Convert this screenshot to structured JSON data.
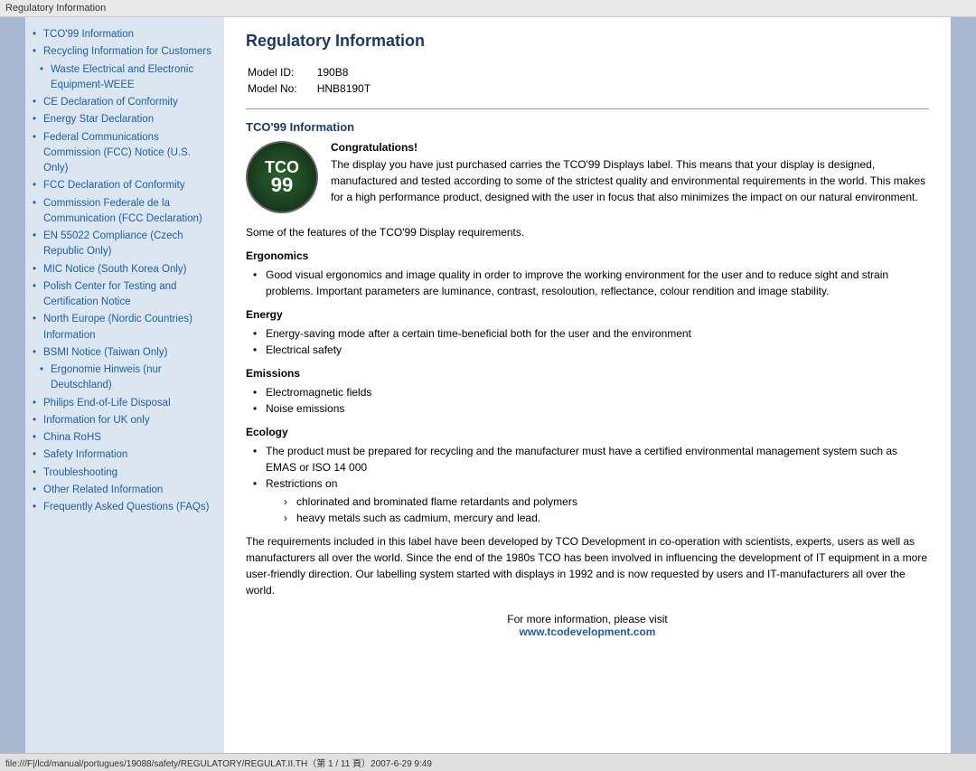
{
  "titleBar": {
    "label": "Regulatory Information"
  },
  "sidebar": {
    "items": [
      {
        "label": "TCO'99 Information",
        "indent": false
      },
      {
        "label": "Recycling Information for Customers",
        "indent": false
      },
      {
        "label": "Waste Electrical and Electronic Equipment-WEEE",
        "indent": true
      },
      {
        "label": "CE Declaration of Conformity",
        "indent": false
      },
      {
        "label": "Energy Star Declaration",
        "indent": false
      },
      {
        "label": "Federal Communications Commission (FCC) Notice (U.S. Only)",
        "indent": false
      },
      {
        "label": "FCC Declaration of Conformity",
        "indent": false
      },
      {
        "label": "Commission Federale de la Communication (FCC Declaration)",
        "indent": false
      },
      {
        "label": "EN 55022 Compliance (Czech Republic Only)",
        "indent": false
      },
      {
        "label": "MIC Notice (South Korea Only)",
        "indent": false
      },
      {
        "label": "Polish Center for Testing and Certification Notice",
        "indent": false
      },
      {
        "label": "North Europe (Nordic Countries) Information",
        "indent": false
      },
      {
        "label": "BSMI Notice (Taiwan Only)",
        "indent": false
      },
      {
        "label": "Ergonomie Hinweis (nur Deutschland)",
        "indent": true
      },
      {
        "label": "Philips End-of-Life Disposal",
        "indent": false
      },
      {
        "label": "Information for UK only",
        "indent": false
      },
      {
        "label": "China RoHS",
        "indent": false
      },
      {
        "label": "Safety Information",
        "indent": false
      },
      {
        "label": "Troubleshooting",
        "indent": false
      },
      {
        "label": "Other Related Information",
        "indent": false
      },
      {
        "label": "Frequently Asked Questions (FAQs)",
        "indent": false
      }
    ]
  },
  "content": {
    "title": "Regulatory Information",
    "modelId": {
      "label": "Model ID:",
      "value": "190B8"
    },
    "modelNo": {
      "label": "Model No:",
      "value": "HNB8190T"
    },
    "tcoSection": {
      "heading": "TCO'99 Information",
      "congratsBold": "Congratulations!",
      "congratsText": "The display you have just purchased carries the TCO'99 Displays label. This means that your display is designed, manufactured and tested according to some of the strictest quality and environmental requirements in the world. This makes for a high performance product, designed with the user in focus that also minimizes the impact on our natural environment.",
      "featuresIntro": "Some of the features of the TCO'99 Display requirements.",
      "ergonomicsHeading": "Ergonomics",
      "ergonomicsItems": [
        "Good visual ergonomics and image quality in order to improve the working environment for the user and to reduce sight and strain problems. Important parameters are luminance, contrast, resoloution, reflectance, colour rendition and image stability."
      ],
      "energyHeading": "Energy",
      "energyItems": [
        "Energy-saving mode after a certain time-beneficial both for the user and the environment",
        "Electrical safety"
      ],
      "emissionsHeading": "Emissions",
      "emissionsItems": [
        "Electromagnetic fields",
        "Noise emissions"
      ],
      "ecologyHeading": "Ecology",
      "ecologyItems": [
        "The product must be prepared for recycling and the manufacturer must have a certified environmental management system such as EMAS or ISO 14 000",
        "Restrictions on"
      ],
      "ecologySubItems": [
        "chlorinated and brominated flame retardants and polymers",
        "heavy metals such as cadmium, mercury and lead."
      ],
      "closingText": "The requirements included in this label have been developed by TCO Development in co-operation with scientists, experts, users as well as manufacturers all over the world. Since the end of the 1980s TCO has been involved in influencing the development of IT equipment in a more user-friendly direction. Our labelling system started with displays in 1992 and is now requested by users and IT-manufacturers all over the world.",
      "footerText": "For more information, please visit",
      "footerLink": "www.tcodevelopment.com"
    }
  },
  "statusBar": {
    "text": "file:///F|/lcd/manual/portugues/19088/safety/REGULATORY/REGULAT.II.TH（第 1 / 11 頁）2007-6-29 9:49"
  }
}
